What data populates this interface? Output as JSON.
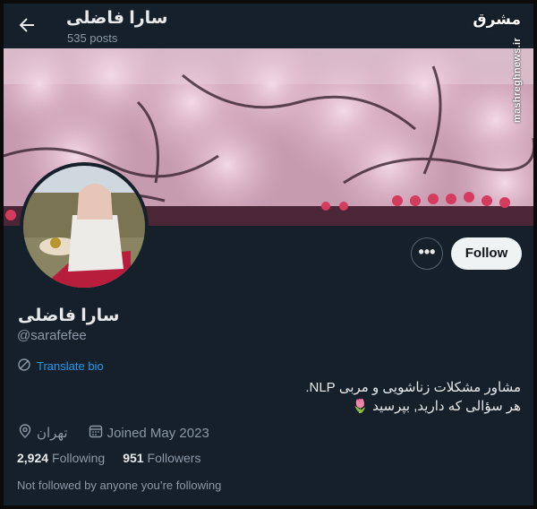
{
  "header": {
    "title": "سارا فاضلی",
    "post_count": "535 posts"
  },
  "watermark": {
    "logo_text": "مشرق",
    "url": "mashreghnews.ir"
  },
  "profile": {
    "name": "سارا فاضلی",
    "handle": "@sarafefee",
    "translate_label": "Translate bio",
    "bio_line1": "مشاور مشکلات زناشویی و مربی NLP.",
    "bio_line2": "هر سؤالی که دارید, بپرسید 🌷",
    "location": "تهران",
    "joined": "Joined May 2023",
    "following_count": "2,924",
    "following_label": "Following",
    "followers_count": "951",
    "followers_label": "Followers",
    "not_followed": "Not followed by anyone you’re following"
  },
  "actions": {
    "more_label": "•••",
    "follow_label": "Follow"
  },
  "colors": {
    "background": "#15202b",
    "accent": "#1d9bf0",
    "muted": "#8b98a5",
    "text": "#e7e9ea"
  },
  "icons": [
    "back-arrow-icon",
    "translate-icon",
    "location-icon",
    "calendar-icon"
  ]
}
